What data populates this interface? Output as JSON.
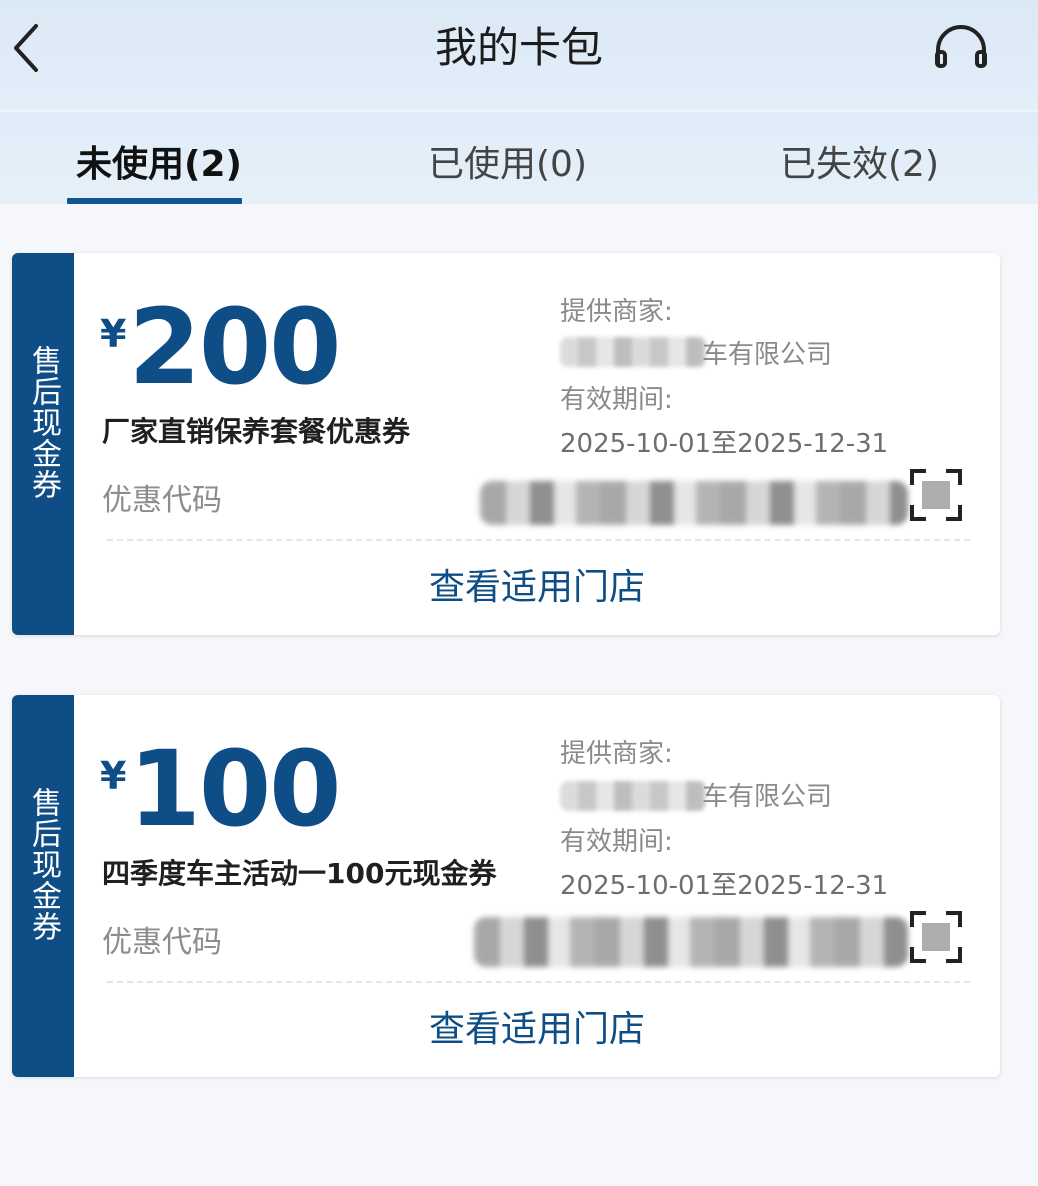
{
  "header": {
    "title": "我的卡包",
    "back_icon": "chevron-left-icon",
    "service_icon": "headset-icon"
  },
  "tabs": [
    {
      "label": "未使用(2)",
      "active": true
    },
    {
      "label": "已使用(0)",
      "active": false
    },
    {
      "label": "已失效(2)",
      "active": false
    }
  ],
  "colors": {
    "brand": "#0e4d86",
    "tab_underline": "#125591",
    "header_bg": "#dbe9f6"
  },
  "coupons": [
    {
      "category": "售后现金券",
      "currency": "¥",
      "amount": "200",
      "name": "厂家直销保养套餐优惠券",
      "code_label": "优惠代码",
      "merchant_label": "提供商家:",
      "merchant_value": "车有限公司",
      "validity_label": "有效期间:",
      "validity_value": "2025-10-01至2025-12-31",
      "store_link": "查看适用门店"
    },
    {
      "category": "售后现金券",
      "currency": "¥",
      "amount": "100",
      "name": "四季度车主活动一100元现金券",
      "code_label": "优惠代码",
      "merchant_label": "提供商家:",
      "merchant_value": "车有限公司",
      "validity_label": "有效期间:",
      "validity_value": "2025-10-01至2025-12-31",
      "store_link": "查看适用门店"
    }
  ]
}
